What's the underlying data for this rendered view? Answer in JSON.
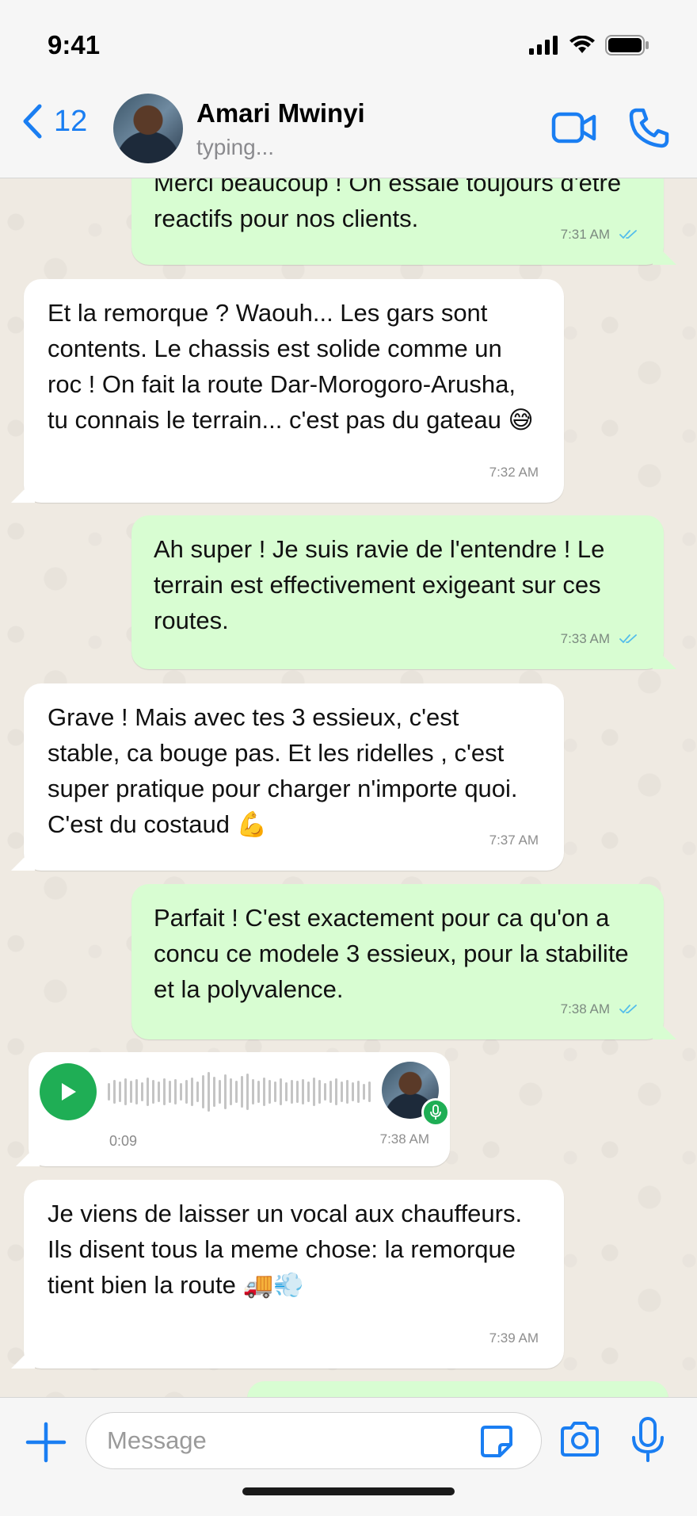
{
  "status_bar": {
    "time": "9:41"
  },
  "header": {
    "back_count": "12",
    "contact_name": "Amari Mwinyi",
    "contact_status": "typing..."
  },
  "messages": [
    {
      "dir": "out",
      "text": "Merci beaucoup ! On essaie toujours d'etre reactifs pour nos clients.",
      "time": "7:31 AM"
    },
    {
      "dir": "in",
      "text": "Et la remorque ? Waouh... Les gars sont contents. Le chassis est solide comme un roc ! On fait la route Dar-Morogoro-Arusha, tu connais le terrain... c'est pas du gateau 😅",
      "time": "7:32 AM"
    },
    {
      "dir": "out",
      "text": "Ah super ! Je suis ravie de l'entendre ! Le terrain est effectivement exigeant sur ces routes.",
      "time": "7:33 AM"
    },
    {
      "dir": "in",
      "text": "Grave ! Mais avec tes 3 essieux, c'est stable, ca bouge pas. Et les ridelles , c'est super pratique pour charger n'importe quoi. C'est du costaud 💪",
      "time": "7:37 AM"
    },
    {
      "dir": "out",
      "text": "Parfait ! C'est exactement pour ca qu'on a concu ce modele 3 essieux, pour la stabilite et la polyvalence.",
      "time": "7:38 AM"
    },
    {
      "dir": "in",
      "voice_duration": "0:09",
      "time": "7:38 AM"
    },
    {
      "dir": "in",
      "text": "Je viens de laisser un vocal aux chauffeurs. Ils disent tous la meme chose: la remorque tient bien la route 🚚💨",
      "time": "7:39 AM"
    }
  ],
  "input": {
    "placeholder": "Message"
  },
  "colors": {
    "accent": "#1a7ef2",
    "outgoing": "#d8fdd2",
    "incoming": "#ffffff",
    "voice": "#1fae55",
    "read_check": "#53bdeb"
  },
  "icons": [
    "signal-icon",
    "wifi-icon",
    "battery-icon",
    "back-chevron-icon",
    "video-call-icon",
    "phone-icon",
    "read-check-icon",
    "play-icon",
    "mic-icon",
    "plus-icon",
    "sticker-icon",
    "camera-icon"
  ]
}
